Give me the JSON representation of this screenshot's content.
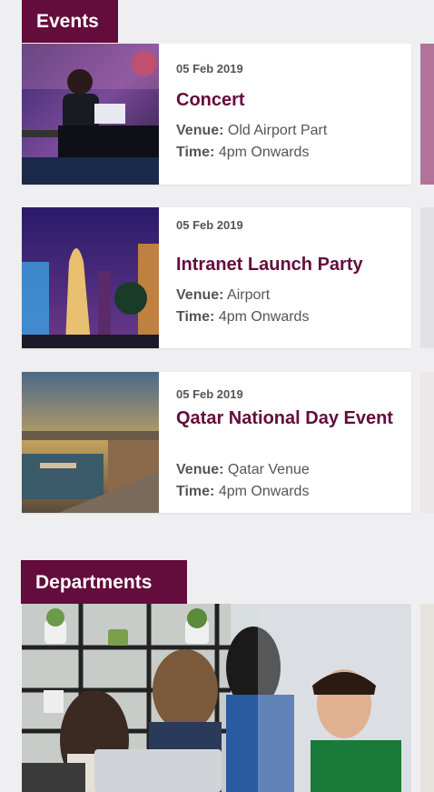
{
  "events": {
    "section_title": "Events",
    "venue_label": "Venue:",
    "time_label": "Time:",
    "items": [
      {
        "date": "05 Feb 2019",
        "title": "Concert",
        "venue": "Old Airport Part",
        "time": "4pm Onwards"
      },
      {
        "date": "05 Feb 2019",
        "title": "Intranet Launch Party",
        "venue": "Airport",
        "time": "4pm Onwards"
      },
      {
        "date": "05 Feb 2019",
        "title": "Qatar National Day Event",
        "venue": "Qatar Venue",
        "time": "4pm Onwards"
      }
    ]
  },
  "departments": {
    "section_title": "Departments"
  },
  "colors": {
    "accent": "#640c3c",
    "background": "#efeff1"
  }
}
